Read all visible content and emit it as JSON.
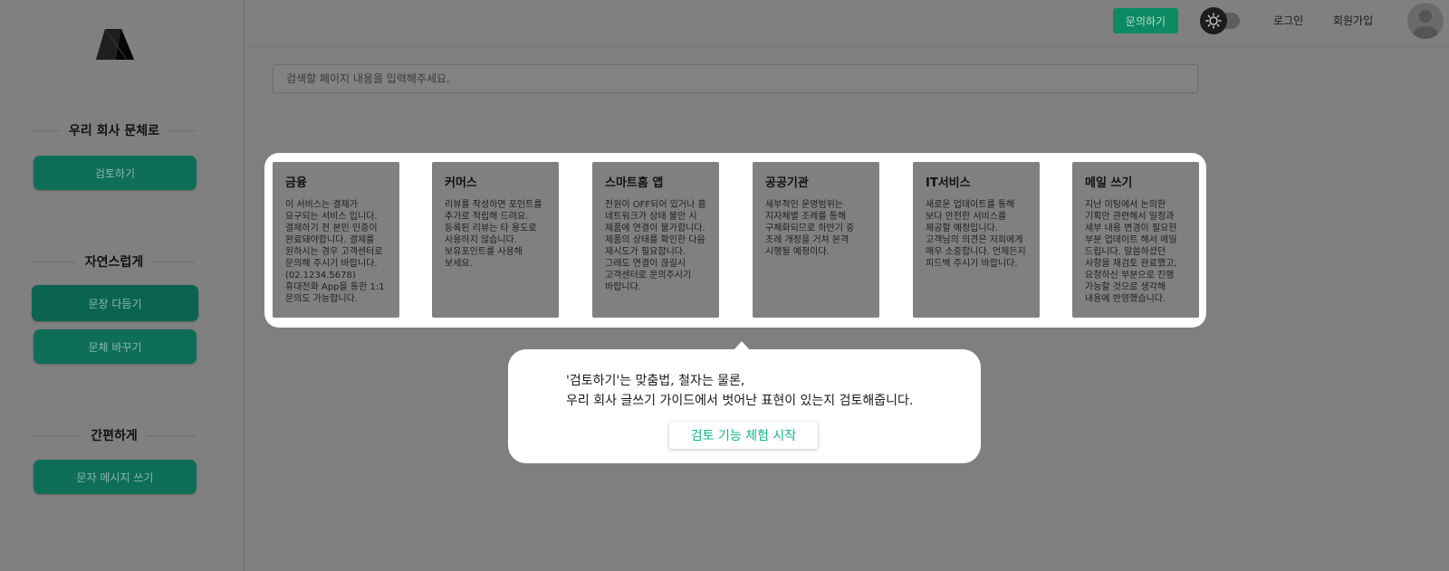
{
  "sidebar": {
    "sections": [
      {
        "title": "우리 회사 문체로",
        "buttons": [
          "검토하기"
        ]
      },
      {
        "title": "자연스럽게",
        "buttons": [
          "문장 다듬기",
          "문체 바꾸기"
        ]
      },
      {
        "title": "간편하게",
        "buttons": [
          "문자 메시지 쓰기"
        ]
      }
    ]
  },
  "header": {
    "contact_label": "문의하기",
    "login_label": "로그인",
    "signup_label": "회원가입"
  },
  "search": {
    "placeholder": "검색할 페이지 내용을 입력해주세요."
  },
  "cards": [
    {
      "title": "금융",
      "body": "이 서비스는 결제가\n요구되는 서비스 입니다.\n결제하기 전 본인 인증이\n완료돼야합니다. 결제를\n원하시는 경우 고객센터로\n문의해 주시기 바랍니다.\n(02.1234.5678)\n휴대전화 App을 통한 1:1\n문의도 가능합니다."
    },
    {
      "title": "커머스",
      "body": "리뷰를 작성하면 포인트를\n추가로 적립해 드려요.\n등록된 리뷰는 타 용도로\n사용하지 않습니다.\n보유포인트를 사용해\n보세요."
    },
    {
      "title": "스마트홈 앱",
      "body": "전원이 OFF되어 있거나 홈\n네트워크가 상태 불안 시\n제품에 연결이 불가합니다.\n제품의 상태를 확인한 다음\n재시도가 필요합니다.\n그래도 연결이 끊길시\n고객센터로 문의주시기\n바랍니다."
    },
    {
      "title": "공공기관",
      "body": "세부적인 운영범위는\n지자체별 조례를 통해\n구체화되므로 하반기 중\n조례 개정을 거쳐 본격\n시행될 예정이다."
    },
    {
      "title": "IT서비스",
      "body": "새로운 업데이트를 통해\n보다 안전한 서비스를\n제공할 예정입니다.\n고객님의 의견은 저희에게\n매우 소중합니다. 언제든지\n피드백 주시기 바랍니다."
    },
    {
      "title": "메일 쓰기",
      "body": "지난 미팅에서 논의한\n기획안 관련해서 일정과\n세부 내용 변경이 필요한\n부분 업데이트 해서 메일\n드립니다. 말씀하셨던\n사항을 재검토 완료했고,\n요청하신 부분으로 진행\n가능할 것으로 생각해\n내용에 반영했습니다."
    }
  ],
  "tooltip": {
    "text": "'검토하기'는 맞춤법, 철자는 물론,\n우리 회사 글쓰기 가이드에서 벗어난 표현이 있는지 검토해줍니다.",
    "button_label": "검토 기능 체험 시작"
  }
}
